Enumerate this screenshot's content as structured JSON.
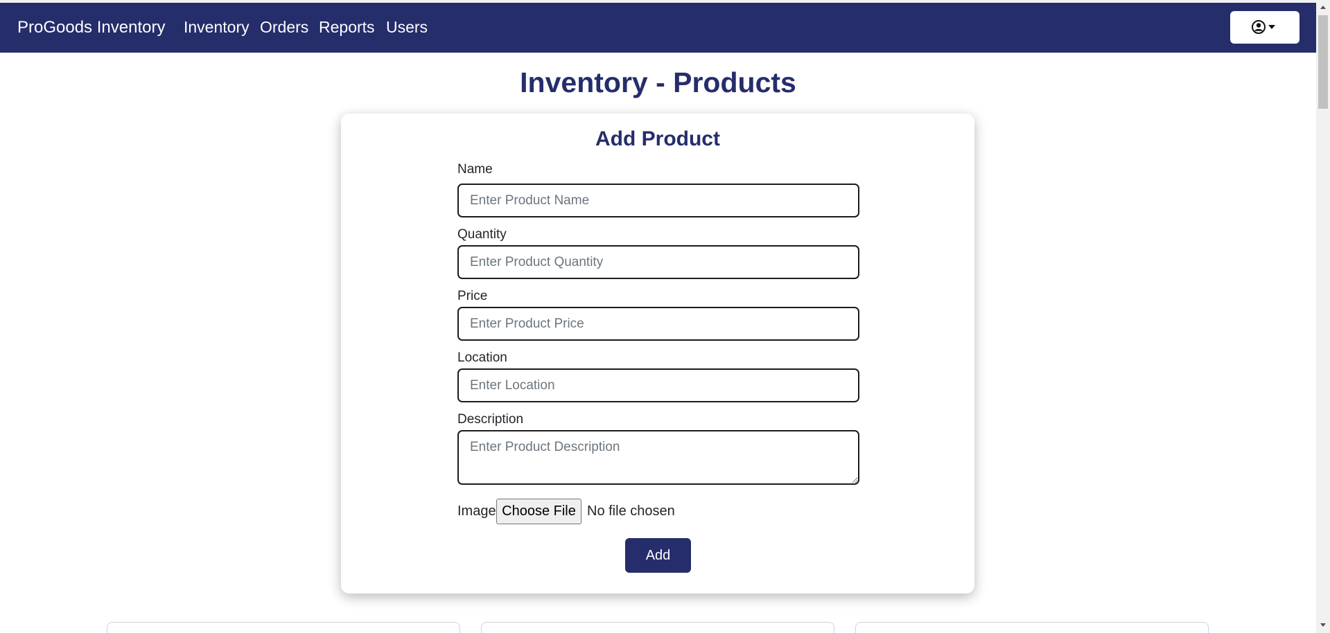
{
  "nav": {
    "brand": "ProGoods Inventory",
    "links": [
      "Inventory",
      "Orders",
      "Reports",
      "Users"
    ],
    "user_icon": "user-circle-icon",
    "dropdown_icon": "caret-down-icon"
  },
  "page": {
    "title": "Inventory - Products"
  },
  "form": {
    "title": "Add Product",
    "fields": [
      {
        "label": "Name",
        "placeholder": "Enter Product Name"
      },
      {
        "label": "Quantity",
        "placeholder": "Enter Product Quantity"
      },
      {
        "label": "Price",
        "placeholder": "Enter Product Price"
      },
      {
        "label": "Location",
        "placeholder": "Enter Location"
      },
      {
        "label": "Description",
        "placeholder": "Enter Product Description"
      }
    ],
    "image_label": "Image",
    "choose_file_label": "Choose File",
    "file_status": "No file chosen",
    "submit_label": "Add"
  },
  "colors": {
    "navbar": "#252d6b",
    "accent": "#252d6b",
    "page_bg": "#ffffff"
  }
}
